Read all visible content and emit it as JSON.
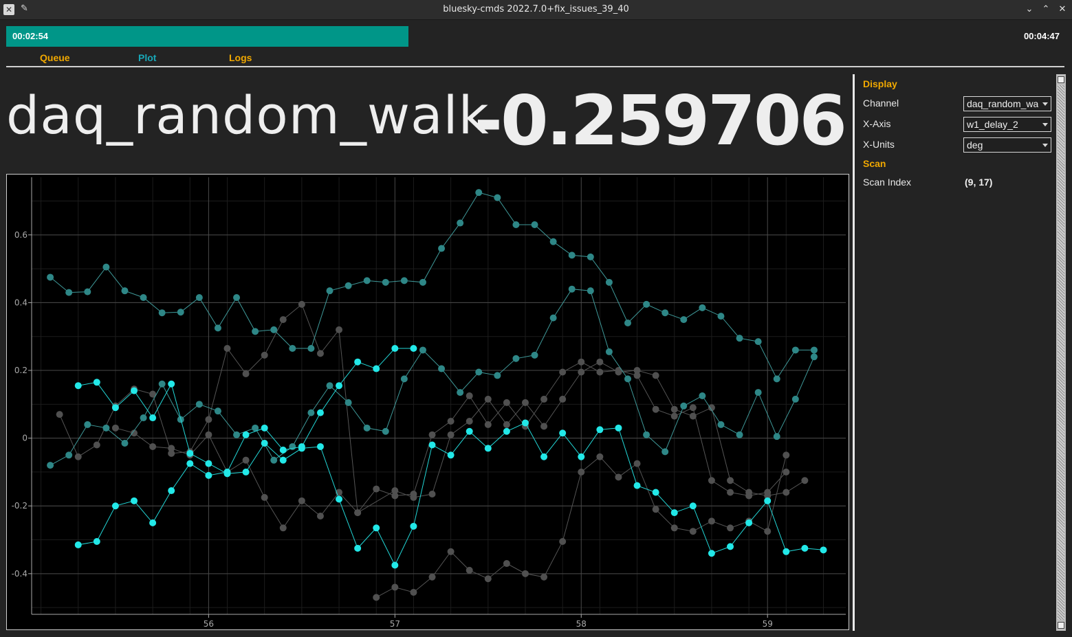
{
  "window": {
    "title": "bluesky-cmds 2022.7.0+fix_issues_39_40"
  },
  "progress": {
    "elapsed": "00:02:54",
    "total": "00:04:47",
    "fraction": 0.468
  },
  "tabs": [
    {
      "label": "Queue",
      "active": false
    },
    {
      "label": "Plot",
      "active": true
    },
    {
      "label": "Logs",
      "active": false
    }
  ],
  "readout": {
    "channel": "daq_random_walk",
    "value": "-0.259706"
  },
  "panel": {
    "display_heading": "Display",
    "channel_label": "Channel",
    "channel_value": "daq_random_walk",
    "xaxis_label": "X-Axis",
    "xaxis_value": "w1_delay_2",
    "xunits_label": "X-Units",
    "xunits_value": "deg",
    "scan_heading": "Scan",
    "scan_index_label": "Scan Index",
    "scan_index_value": "(9, 17)"
  },
  "colors": {
    "accent": "#009688",
    "heading": "#f0a800",
    "active_tab": "#18a8b8",
    "current_series": "#20e8e8"
  },
  "chart_data": {
    "type": "scatter",
    "xlim": [
      55.05,
      59.42
    ],
    "ylim": [
      -0.52,
      0.77
    ],
    "x_ticks": [
      56,
      57,
      58,
      59
    ],
    "y_ticks": [
      -0.4,
      -0.2,
      0,
      0.2,
      0.4,
      0.6
    ],
    "grid": true,
    "series": [
      {
        "style": "gray",
        "x": [
          56.9,
          57.0,
          57.1,
          57.2,
          57.3,
          57.4,
          57.5,
          57.6,
          57.7,
          57.8,
          57.9,
          58.0,
          58.1,
          58.2,
          58.3,
          58.4,
          58.5,
          58.6,
          58.7,
          58.8,
          58.9,
          59.0,
          59.1
        ],
        "y": [
          -0.47,
          -0.44,
          -0.455,
          -0.41,
          -0.335,
          -0.39,
          -0.415,
          -0.37,
          -0.4,
          -0.41,
          -0.305,
          -0.1,
          -0.055,
          -0.115,
          -0.075,
          -0.21,
          -0.265,
          -0.275,
          -0.245,
          -0.265,
          -0.245,
          -0.275,
          -0.05
        ]
      },
      {
        "style": "gray",
        "x": [
          55.2,
          55.3,
          55.4,
          55.5,
          55.6,
          55.7,
          55.8,
          55.9,
          56.0,
          56.1,
          56.2,
          56.3,
          56.4,
          56.5,
          56.6,
          56.7,
          56.8,
          56.9,
          57.0,
          57.1,
          57.2,
          57.3,
          57.4,
          57.5,
          57.6,
          57.7,
          57.8,
          57.9,
          58.0,
          58.1,
          58.2,
          58.3,
          58.4,
          58.5,
          58.6,
          58.7,
          58.8,
          58.9,
          59.0,
          59.1
        ],
        "y": [
          0.07,
          -0.055,
          -0.02,
          0.095,
          0.145,
          0.13,
          -0.045,
          -0.04,
          0.055,
          0.265,
          0.19,
          0.245,
          0.35,
          0.395,
          0.25,
          0.32,
          -0.22,
          -0.15,
          -0.17,
          -0.165,
          0.01,
          0.05,
          0.125,
          0.04,
          0.105,
          0.035,
          0.115,
          0.195,
          0.225,
          0.195,
          0.2,
          0.185,
          0.085,
          0.065,
          0.09,
          -0.125,
          -0.16,
          -0.17,
          -0.16,
          -0.1
        ]
      },
      {
        "style": "gray",
        "x": [
          55.5,
          55.6,
          55.7,
          55.8,
          55.9,
          56.0,
          56.1,
          56.2,
          56.3,
          56.4,
          56.5,
          56.6,
          56.7,
          56.8,
          57.0,
          57.1,
          57.2,
          57.3,
          57.4,
          57.5,
          57.6,
          57.7,
          57.8,
          57.9,
          58.0,
          58.1,
          58.2,
          58.3,
          58.4,
          58.5,
          58.6,
          58.7,
          58.8,
          58.9,
          59.0,
          59.1,
          59.2
        ],
        "y": [
          0.03,
          0.015,
          -0.025,
          -0.03,
          -0.05,
          0.01,
          -0.1,
          -0.065,
          -0.175,
          -0.265,
          -0.185,
          -0.23,
          -0.16,
          -0.22,
          -0.155,
          -0.175,
          -0.165,
          0.01,
          0.05,
          0.115,
          0.04,
          0.105,
          0.035,
          0.115,
          0.195,
          0.225,
          0.195,
          0.2,
          0.185,
          0.085,
          0.065,
          0.09,
          -0.125,
          -0.16,
          -0.17,
          -0.16,
          -0.125
        ]
      },
      {
        "style": "teal-dim",
        "x": [
          55.15,
          55.25,
          55.35,
          55.45,
          55.55,
          55.65,
          55.75,
          55.85,
          55.95,
          56.05,
          56.15,
          56.25,
          56.35,
          56.45,
          56.55,
          56.65,
          56.75,
          56.85,
          56.95,
          57.05,
          57.15,
          57.25,
          57.35,
          57.45,
          57.55,
          57.65,
          57.75,
          57.85,
          57.95,
          58.05,
          58.15,
          58.25,
          58.35,
          58.45,
          58.55,
          58.65,
          58.75,
          58.85,
          58.95,
          59.05,
          59.15,
          59.25
        ],
        "y": [
          0.475,
          0.43,
          0.432,
          0.505,
          0.435,
          0.415,
          0.37,
          0.372,
          0.415,
          0.325,
          0.415,
          0.315,
          0.32,
          0.265,
          0.265,
          0.435,
          0.45,
          0.465,
          0.46,
          0.465,
          0.46,
          0.56,
          0.635,
          0.725,
          0.71,
          0.63,
          0.63,
          0.58,
          0.54,
          0.535,
          0.46,
          0.34,
          0.395,
          0.37,
          0.35,
          0.385,
          0.36,
          0.295,
          0.285,
          0.175,
          0.26,
          0.26
        ]
      },
      {
        "style": "teal-dim",
        "x": [
          55.15,
          55.25,
          55.35,
          55.45,
          55.55,
          55.65,
          55.75,
          55.85,
          55.95,
          56.05,
          56.15,
          56.25,
          56.35,
          56.45,
          56.55,
          56.65,
          56.75,
          56.85,
          56.95,
          57.05,
          57.15,
          57.25,
          57.35,
          57.45,
          57.55,
          57.65,
          57.75,
          57.85,
          57.95,
          58.05,
          58.15,
          58.25,
          58.35,
          58.45,
          58.55,
          58.65,
          58.75,
          58.85,
          58.95,
          59.05,
          59.15,
          59.25
        ],
        "y": [
          -0.08,
          -0.05,
          0.04,
          0.03,
          -0.015,
          0.06,
          0.16,
          0.055,
          0.1,
          0.08,
          0.01,
          0.03,
          -0.065,
          -0.025,
          0.075,
          0.155,
          0.105,
          0.03,
          0.02,
          0.175,
          0.26,
          0.205,
          0.135,
          0.195,
          0.185,
          0.235,
          0.245,
          0.355,
          0.44,
          0.435,
          0.255,
          0.175,
          0.01,
          -0.04,
          0.095,
          0.125,
          0.04,
          0.01,
          0.135,
          0.005,
          0.115,
          0.24
        ]
      },
      {
        "style": "cyan-bright",
        "x": [
          55.3,
          55.4,
          55.5,
          55.6,
          55.7,
          55.8,
          55.9,
          56.0,
          56.1,
          56.2,
          56.3,
          56.4,
          56.5,
          56.6,
          56.7,
          56.8,
          56.9,
          57.0,
          57.1,
          57.2,
          57.3,
          57.4,
          57.5,
          57.6,
          57.7,
          57.8,
          57.9,
          58.0,
          58.1,
          58.2,
          58.3,
          58.4,
          58.5,
          58.6,
          58.7,
          58.8,
          58.9,
          59.0,
          59.1,
          59.2,
          59.3
        ],
        "y": [
          0.155,
          0.165,
          0.09,
          0.14,
          0.06,
          0.16,
          -0.045,
          -0.075,
          -0.105,
          -0.1,
          -0.015,
          -0.065,
          -0.03,
          -0.025,
          -0.18,
          -0.325,
          -0.265,
          -0.375,
          -0.26,
          -0.02,
          -0.05,
          0.02,
          -0.03,
          0.02,
          0.045,
          -0.055,
          0.015,
          -0.055,
          0.025,
          0.03,
          -0.14,
          -0.16,
          -0.22,
          -0.2,
          -0.34,
          -0.32,
          -0.25,
          -0.185,
          -0.335,
          -0.325,
          -0.33
        ]
      },
      {
        "style": "cyan-bright",
        "x": [
          55.3,
          55.4,
          55.5,
          55.6,
          55.7,
          55.8,
          55.9,
          56.0,
          56.1,
          56.2,
          56.3,
          56.4,
          56.5,
          56.6,
          56.7,
          56.8,
          56.9,
          57.0,
          57.1
        ],
        "y": [
          -0.315,
          -0.305,
          -0.2,
          -0.185,
          -0.25,
          -0.155,
          -0.075,
          -0.11,
          -0.1,
          0.01,
          0.03,
          -0.035,
          -0.025,
          0.075,
          0.155,
          0.225,
          0.205,
          0.265,
          0.265
        ]
      }
    ]
  }
}
